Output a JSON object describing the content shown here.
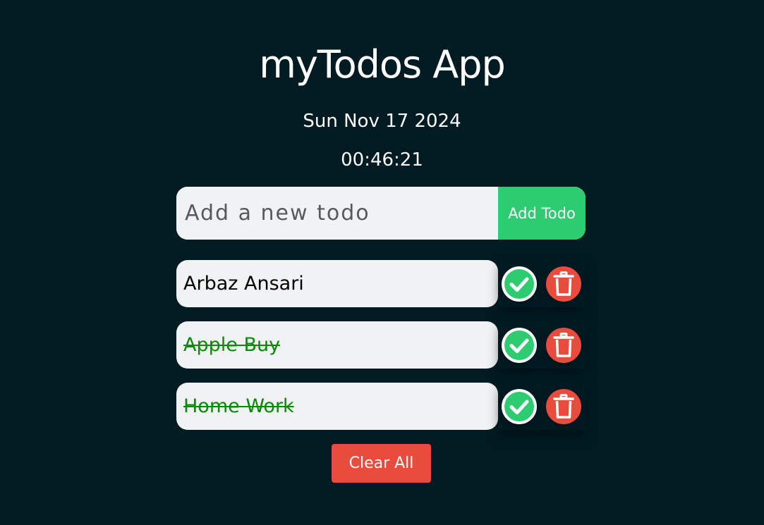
{
  "app": {
    "title": "myTodos App",
    "date": "Sun Nov 17 2024",
    "time": "00:46:21"
  },
  "form": {
    "placeholder": "Add a new todo",
    "value": "",
    "add_label": "Add Todo"
  },
  "todos": [
    {
      "text": "Arbaz Ansari",
      "completed": false
    },
    {
      "text": "Apple Buy",
      "completed": true
    },
    {
      "text": "Home Work",
      "completed": true
    }
  ],
  "icons": {
    "check": "check-circle-icon",
    "delete": "trash-icon"
  },
  "clear_label": "Clear All",
  "colors": {
    "background": "#011b23",
    "accent_green": "#2ecc71",
    "danger_red": "#e74c3c",
    "done_text": "#0a8a0a",
    "field": "#f1f2f4"
  }
}
